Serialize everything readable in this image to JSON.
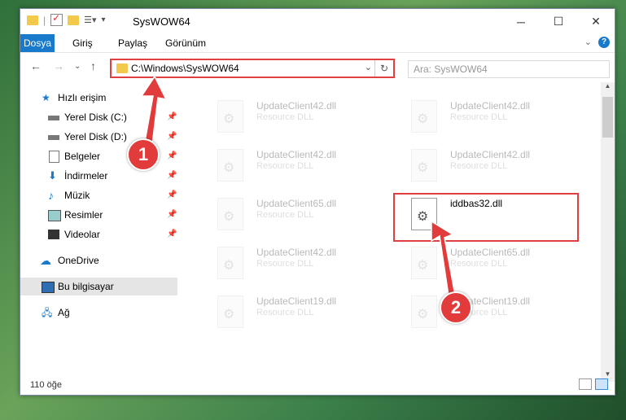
{
  "window": {
    "title": "SysWOW64",
    "controls": [
      "minimize-icon",
      "maximize-icon",
      "close-icon"
    ]
  },
  "ribbon": {
    "tabs": [
      {
        "label": "Dosya",
        "active": true
      },
      {
        "label": "Giriş"
      },
      {
        "label": "Paylaş"
      },
      {
        "label": "Görünüm"
      }
    ],
    "help_label": "?"
  },
  "nav": {
    "address_path": "C:\\Windows\\SysWOW64",
    "search_placeholder": "Ara: SysWOW64"
  },
  "sidebar": {
    "items": [
      {
        "label": "Hızlı erişim",
        "icon": "star-icon"
      },
      {
        "label": "Yerel Disk (C:)",
        "icon": "drive-icon",
        "pinned": true
      },
      {
        "label": "Yerel Disk (D:)",
        "icon": "drive-icon",
        "pinned": true
      },
      {
        "label": "Belgeler",
        "icon": "documents-icon",
        "pinned": true
      },
      {
        "label": "İndirmeler",
        "icon": "download-icon",
        "pinned": true
      },
      {
        "label": "Müzik",
        "icon": "music-icon",
        "pinned": true
      },
      {
        "label": "Resimler",
        "icon": "pictures-icon",
        "pinned": true
      },
      {
        "label": "Videolar",
        "icon": "video-icon",
        "pinned": true
      },
      {
        "label": "OneDrive",
        "icon": "cloud-icon"
      },
      {
        "label": "Bu bilgisayar",
        "icon": "computer-icon",
        "selected": true
      },
      {
        "label": "Ağ",
        "icon": "network-icon"
      }
    ]
  },
  "files": [
    {
      "name": "UpdateClient42.dll",
      "desc": "Resource DLL"
    },
    {
      "name": "UpdateClient42.dll",
      "desc": "Resource DLL"
    },
    {
      "name": "UpdateClient42.dll",
      "desc": "Resource DLL"
    },
    {
      "name": "UpdateClient42.dll",
      "desc": "Resource DLL"
    },
    {
      "name": "UpdateClient65.dll",
      "desc": "Resource DLL"
    },
    {
      "name": "iddbas32.dll",
      "desc": ""
    },
    {
      "name": "UpdateClient42.dll",
      "desc": "Resource DLL"
    },
    {
      "name": "UpdateClient65.dll",
      "desc": "Resource DLL"
    },
    {
      "name": "UpdateClient19.dll",
      "desc": "Resource DLL"
    },
    {
      "name": "UpdateClient19.dll",
      "desc": "Resource DLL"
    }
  ],
  "status": {
    "count_label": "110 öğe"
  },
  "annotations": {
    "step1": "1",
    "step2": "2",
    "color": "#e23b3b"
  }
}
